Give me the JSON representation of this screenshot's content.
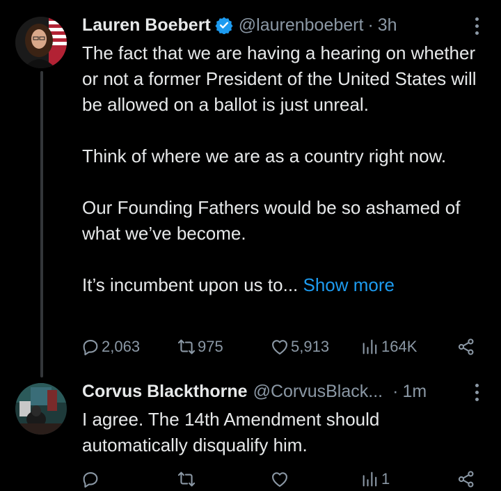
{
  "tweet1": {
    "name": "Lauren Boebert",
    "handle": "@laurenboebert",
    "separator": "·",
    "time": "3h",
    "paragraphs": [
      "The fact that we are having a hearing on whether or not a former President of the United States will be allowed on a ballot is just unreal.",
      "Think of where we are as a country right now.",
      "Our Founding Fathers would be so ashamed of what we’ve become."
    ],
    "truncated_text": "It’s incumbent upon us to...",
    "show_more": "Show more",
    "replies": "2,063",
    "retweets": "975",
    "likes": "5,913",
    "views": "164K"
  },
  "tweet2": {
    "name": "Corvus Blackthorne",
    "handle": "@CorvusBlack...",
    "separator": "·",
    "time": "1m",
    "text": "I agree. The 14th Amendment should automatically disqualify him.",
    "views": "1"
  },
  "colors": {
    "background": "#000000",
    "text": "#e7e9ea",
    "secondary": "#8b98a5",
    "link": "#1d9bf0",
    "verified": "#1d9bf0"
  },
  "icons": [
    "verified-badge-icon",
    "more-icon",
    "reply-icon",
    "retweet-icon",
    "like-icon",
    "views-icon",
    "share-icon"
  ]
}
